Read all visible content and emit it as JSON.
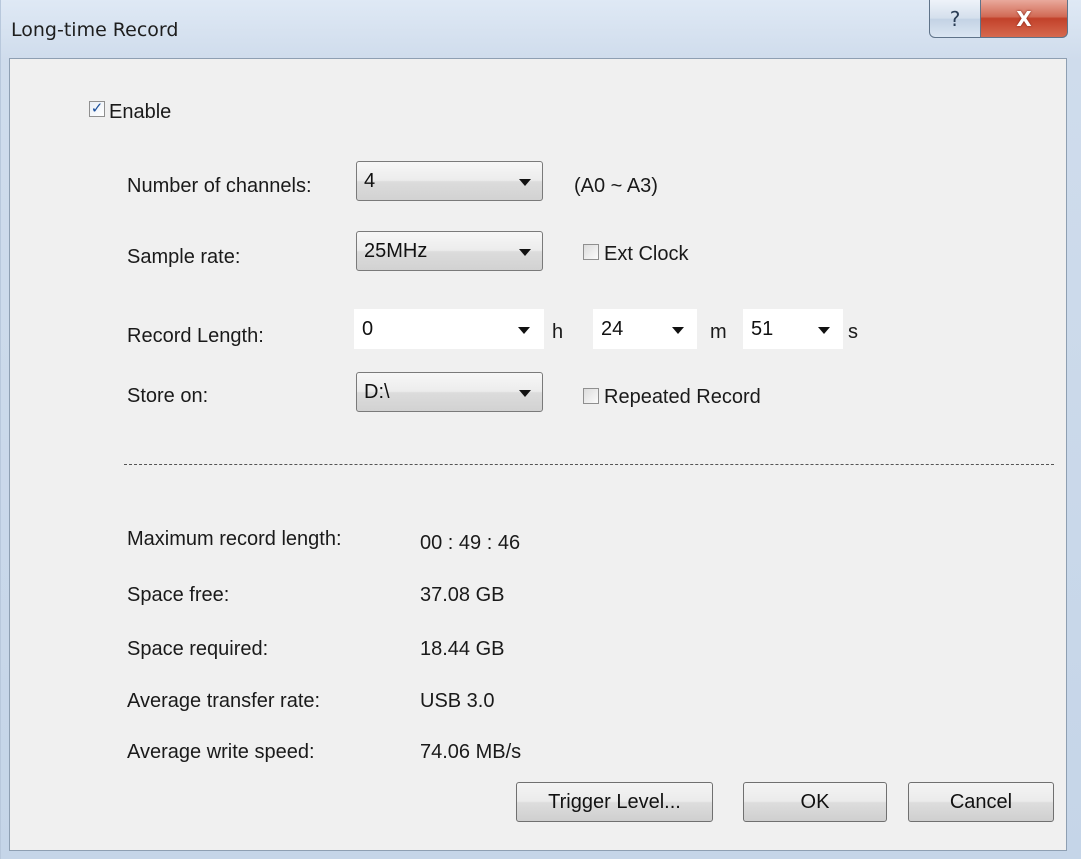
{
  "window": {
    "title": "Long-time Record",
    "help_glyph": "?",
    "close_glyph": "X"
  },
  "enable": {
    "label": "Enable",
    "checked": true
  },
  "channels": {
    "label": "Number of channels:",
    "value": "4",
    "range_note": "(A0 ~ A3)"
  },
  "sample_rate": {
    "label": "Sample rate:",
    "value": "25MHz",
    "ext_clock_label": "Ext Clock",
    "ext_clock_checked": false
  },
  "record_length": {
    "label": "Record Length:",
    "hours": "0",
    "hours_unit": "h",
    "minutes": "24",
    "minutes_unit": "m",
    "seconds": "51",
    "seconds_unit": "s"
  },
  "store_on": {
    "label": "Store on:",
    "value": "D:\\",
    "repeated_label": "Repeated Record",
    "repeated_checked": false
  },
  "info": {
    "max_length_label": "Maximum record length:",
    "max_length_value": "00 : 49 : 46",
    "space_free_label": "Space free:",
    "space_free_value": "37.08 GB",
    "space_required_label": "Space required:",
    "space_required_value": "18.44 GB",
    "transfer_rate_label": "Average transfer rate:",
    "transfer_rate_value": "USB 3.0",
    "write_speed_label": "Average write speed:",
    "write_speed_value": "74.06 MB/s"
  },
  "buttons": {
    "trigger_level": "Trigger Level...",
    "ok": "OK",
    "cancel": "Cancel"
  },
  "colors": {
    "dialog_bg": "#f0f0f0",
    "title_gradient": "#dfe9f5",
    "close_red": "#c2412a",
    "check_blue": "#1b4f9c"
  },
  "icons": {
    "help": "help-icon",
    "close": "close-icon",
    "dropdown": "chevron-down-icon",
    "check": "checkmark-icon"
  }
}
